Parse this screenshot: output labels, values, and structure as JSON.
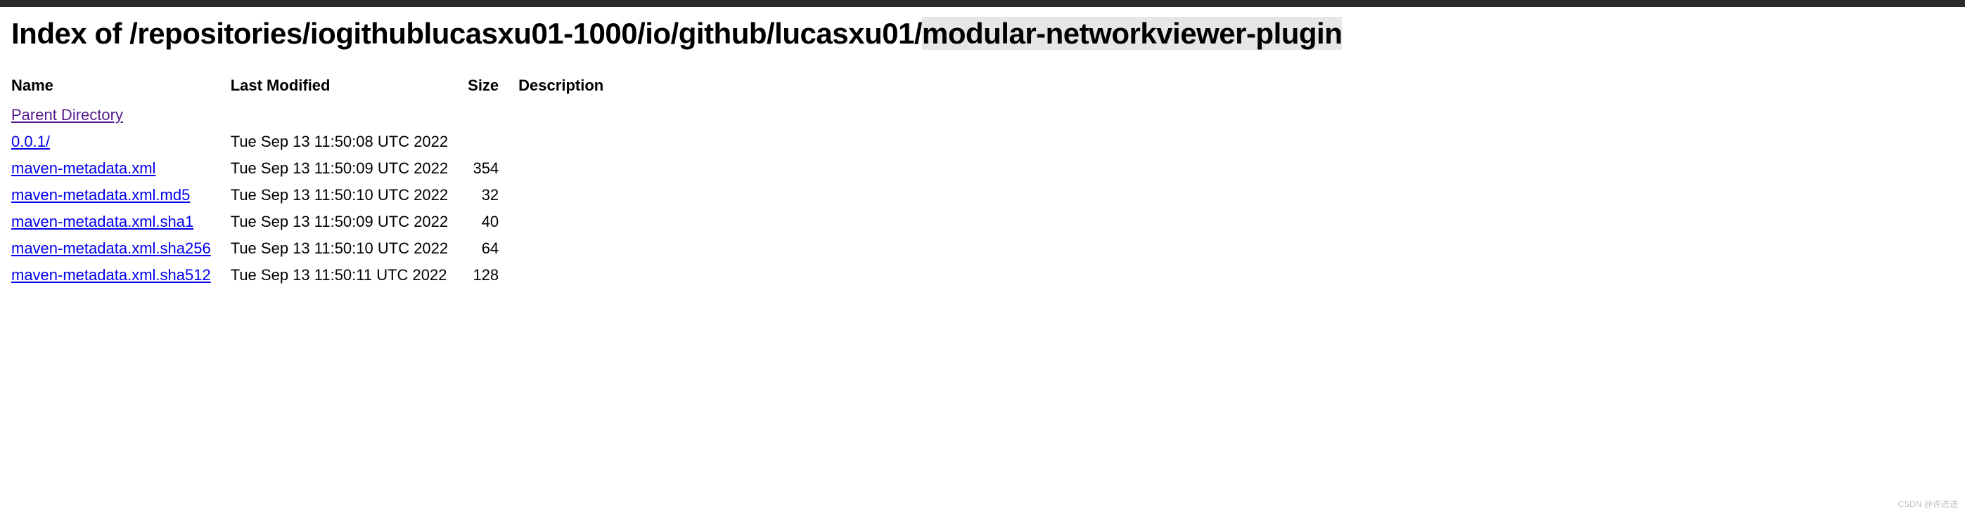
{
  "title": {
    "prefix": "Index of /repositories/iogithublucasxu01-1000/io/github/lucasxu01/",
    "highlight": "modular-networkviewer-plugin"
  },
  "columns": {
    "name": "Name",
    "modified": "Last Modified",
    "size": "Size",
    "description": "Description"
  },
  "rows": [
    {
      "name": "Parent Directory",
      "modified": "",
      "size": "",
      "description": "",
      "link_class": "dir-link"
    },
    {
      "name": "0.0.1/",
      "modified": "Tue Sep 13 11:50:08 UTC 2022",
      "size": "",
      "description": "",
      "link_class": "file-link"
    },
    {
      "name": "maven-metadata.xml",
      "modified": "Tue Sep 13 11:50:09 UTC 2022",
      "size": "354",
      "description": "",
      "link_class": "file-link"
    },
    {
      "name": "maven-metadata.xml.md5",
      "modified": "Tue Sep 13 11:50:10 UTC 2022",
      "size": "32",
      "description": "",
      "link_class": "file-link"
    },
    {
      "name": "maven-metadata.xml.sha1",
      "modified": "Tue Sep 13 11:50:09 UTC 2022",
      "size": "40",
      "description": "",
      "link_class": "file-link"
    },
    {
      "name": "maven-metadata.xml.sha256",
      "modified": "Tue Sep 13 11:50:10 UTC 2022",
      "size": "64",
      "description": "",
      "link_class": "file-link"
    },
    {
      "name": "maven-metadata.xml.sha512",
      "modified": "Tue Sep 13 11:50:11 UTC 2022",
      "size": "128",
      "description": "",
      "link_class": "file-link"
    }
  ],
  "watermark": "CSDN @许进进"
}
